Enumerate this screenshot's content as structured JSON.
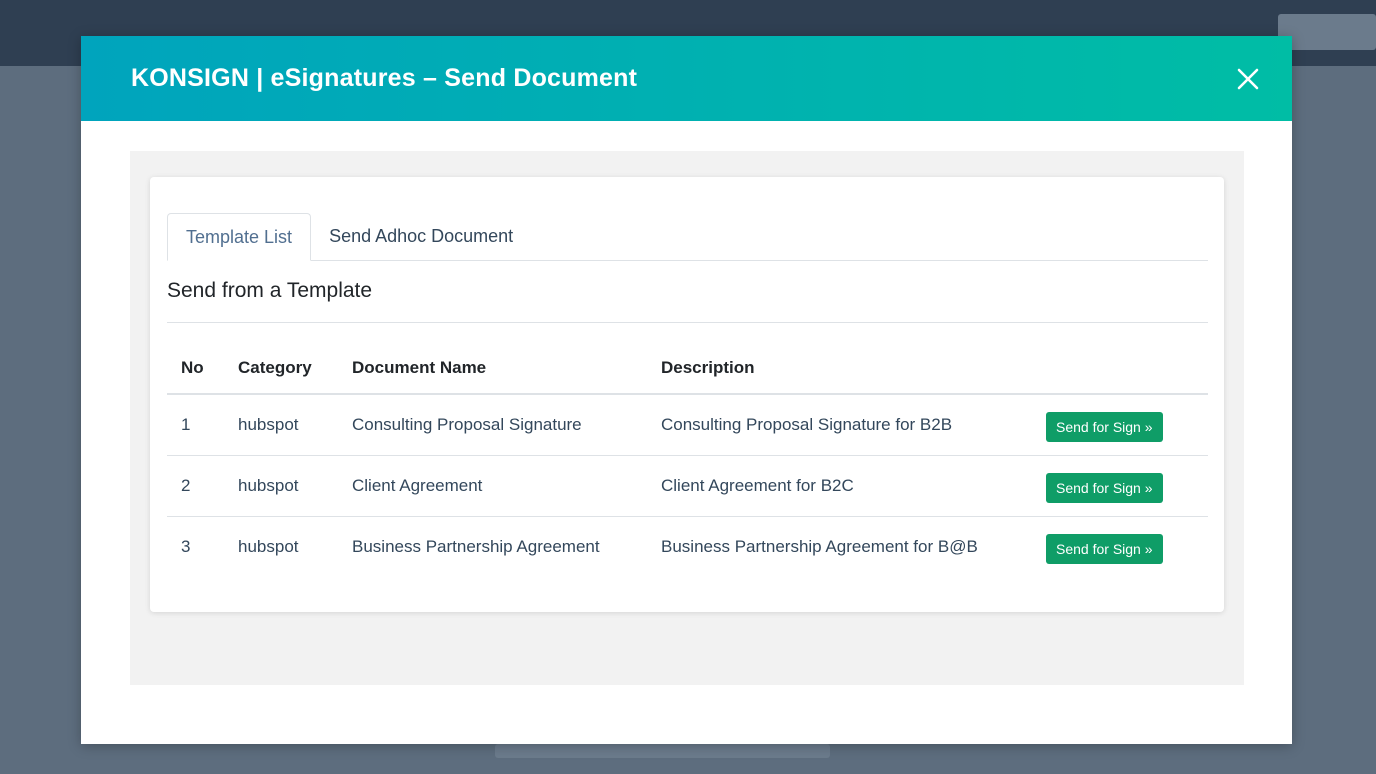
{
  "modal": {
    "title": "KONSIGN | eSignatures – Send Document",
    "close_icon": "close-icon"
  },
  "tabs": [
    {
      "label": "Template List",
      "active": true
    },
    {
      "label": "Send Adhoc Document",
      "active": false
    }
  ],
  "section_title": "Send from a Template",
  "table": {
    "headers": [
      "No",
      "Category",
      "Document Name",
      "Description",
      ""
    ],
    "rows": [
      {
        "no": "1",
        "category": "hubspot",
        "document_name": "Consulting Proposal Signature",
        "description": "Consulting Proposal Signature for B2B",
        "action": "Send for Sign »"
      },
      {
        "no": "2",
        "category": "hubspot",
        "document_name": "Client Agreement",
        "description": "Client Agreement for B2C",
        "action": "Send for Sign »"
      },
      {
        "no": "3",
        "category": "hubspot",
        "document_name": "Business Partnership Agreement",
        "description": "Business Partnership Agreement for B@B",
        "action": "Send for Sign »"
      }
    ]
  },
  "colors": {
    "header_gradient_start": "#00a4bd",
    "header_gradient_end": "#00bda5",
    "button": "#0f9d67"
  }
}
